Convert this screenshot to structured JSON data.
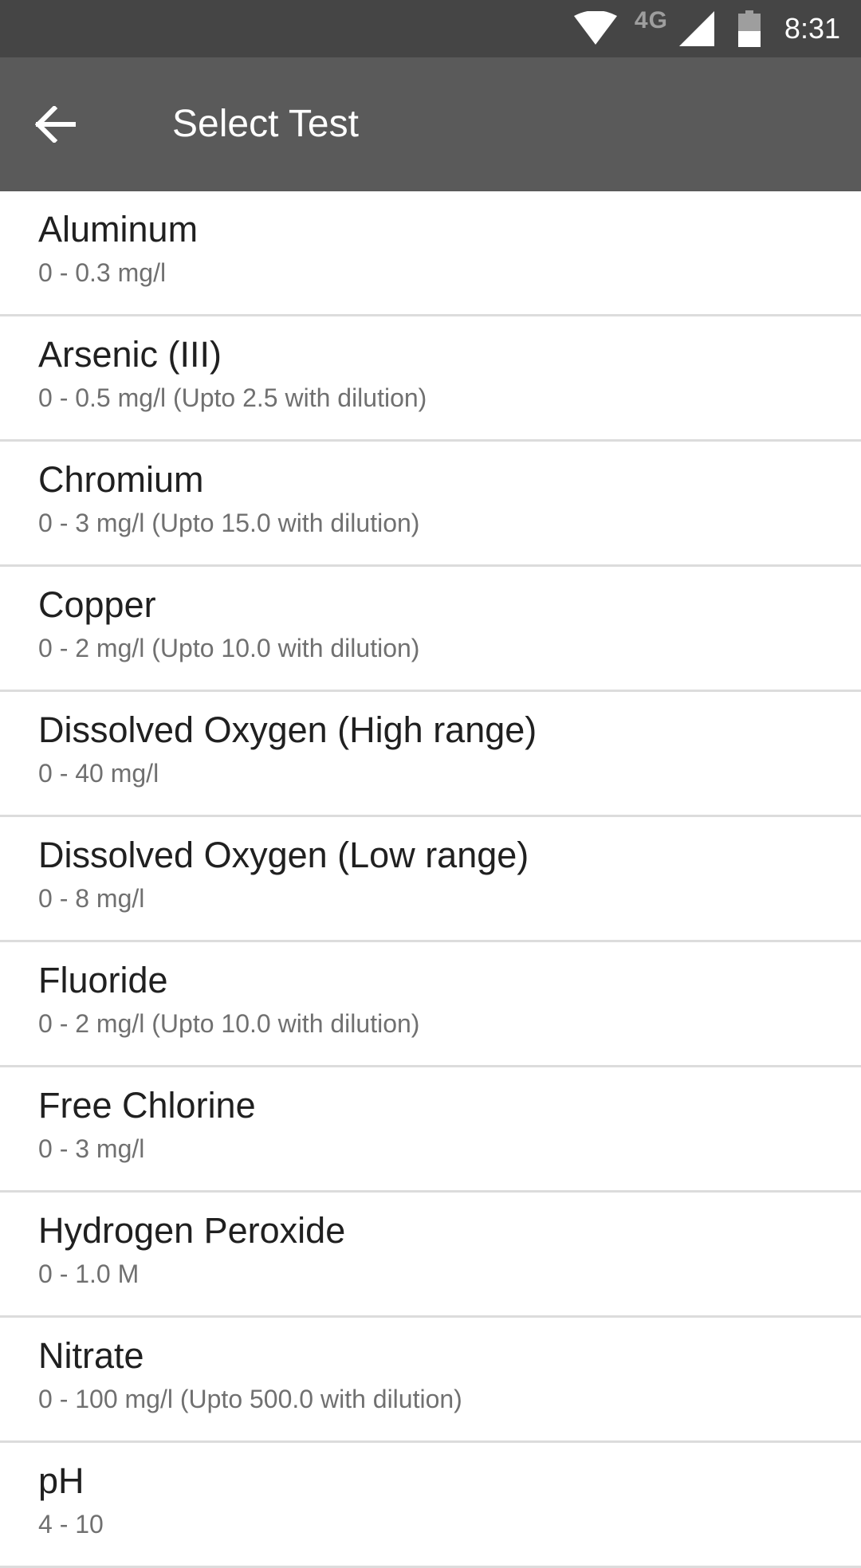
{
  "status_bar": {
    "network_type": "4G",
    "time": "8:31",
    "icons": [
      "wifi-icon",
      "cellular-signal-icon",
      "battery-icon"
    ]
  },
  "app_bar": {
    "title": "Select Test",
    "back_icon": "arrow-left-icon"
  },
  "tests": [
    {
      "name": "Aluminum",
      "range": "0 - 0.3 mg/l"
    },
    {
      "name": "Arsenic (III)",
      "range": "0 - 0.5 mg/l (Upto 2.5 with dilution)"
    },
    {
      "name": "Chromium",
      "range": "0 - 3 mg/l (Upto 15.0 with dilution)"
    },
    {
      "name": "Copper",
      "range": "0 - 2 mg/l (Upto 10.0 with dilution)"
    },
    {
      "name": "Dissolved Oxygen (High range)",
      "range": "0 - 40 mg/l"
    },
    {
      "name": "Dissolved Oxygen (Low range)",
      "range": "0 - 8 mg/l"
    },
    {
      "name": "Fluoride",
      "range": "0 - 2 mg/l (Upto 10.0 with dilution)"
    },
    {
      "name": "Free Chlorine",
      "range": "0 - 3 mg/l"
    },
    {
      "name": "Hydrogen Peroxide",
      "range": "0 - 1.0 M"
    },
    {
      "name": "Nitrate",
      "range": "0 - 100 mg/l (Upto 500.0 with dilution)"
    },
    {
      "name": "pH",
      "range": "4 - 10"
    }
  ],
  "colors": {
    "status_bar": "#454545",
    "app_bar": "#5a5a5a",
    "divider": "#dcdcdc",
    "primary_text": "#202020",
    "secondary_text": "#707070"
  }
}
